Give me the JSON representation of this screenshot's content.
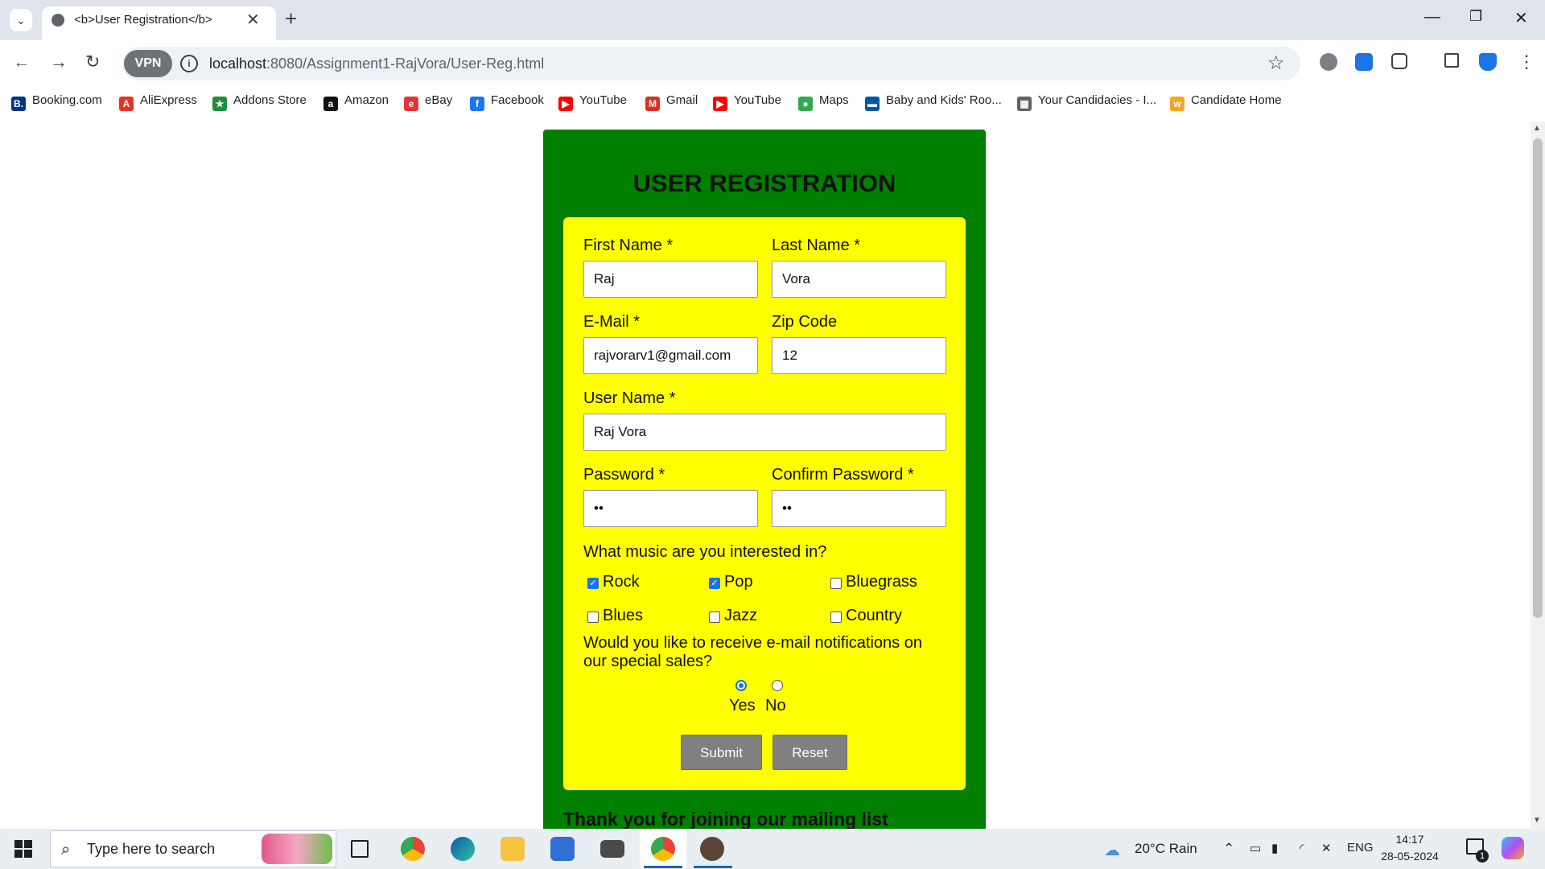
{
  "browser": {
    "tab_title": "<b>User Registration</b>",
    "new_tab": "+",
    "url_host": "localhost",
    "url_rest": ":8080/Assignment1-RajVora/User-Reg.html",
    "vpn_label": "VPN",
    "bookmarks": [
      {
        "label": "Booking.com",
        "icon": "booking-icon",
        "color": "#003580",
        "glyph": "B."
      },
      {
        "label": "AliExpress",
        "icon": "aliexpress-icon",
        "color": "#e43225",
        "glyph": "A"
      },
      {
        "label": "Addons Store",
        "icon": "addons-icon",
        "color": "#1e8e3e",
        "glyph": "★"
      },
      {
        "label": "Amazon",
        "icon": "amazon-icon",
        "color": "#111111",
        "glyph": "a"
      },
      {
        "label": "eBay",
        "icon": "ebay-icon",
        "color": "#e53238",
        "glyph": "e"
      },
      {
        "label": "Facebook",
        "icon": "facebook-icon",
        "color": "#1877f2",
        "glyph": "f"
      },
      {
        "label": "YouTube",
        "icon": "youtube-icon",
        "color": "#ff0000",
        "glyph": "▶"
      },
      {
        "label": "Gmail",
        "icon": "gmail-icon",
        "color": "#d93025",
        "glyph": "M"
      },
      {
        "label": "YouTube",
        "icon": "youtube-icon",
        "color": "#ff0000",
        "glyph": "▶"
      },
      {
        "label": "Maps",
        "icon": "maps-icon",
        "color": "#34a853",
        "glyph": "●"
      },
      {
        "label": "Baby and Kids' Roo...",
        "icon": "ikea-icon",
        "color": "#0058a3",
        "glyph": "▬"
      },
      {
        "label": "Your Candidacies - I...",
        "icon": "candidacies-icon",
        "color": "#5f6368",
        "glyph": "▦"
      },
      {
        "label": "Candidate Home",
        "icon": "workday-icon",
        "color": "#f5a623",
        "glyph": "w"
      }
    ]
  },
  "form": {
    "title": "USER REGISTRATION",
    "first_name_label": "First Name *",
    "first_name_value": "Raj",
    "last_name_label": "Last Name *",
    "last_name_value": "Vora",
    "email_label": "E-Mail *",
    "email_value": "rajvorarv1@gmail.com",
    "zip_label": "Zip Code",
    "zip_value": "12",
    "username_label": "User Name *",
    "username_value": "Raj Vora",
    "password_label": "Password *",
    "password_value": "••",
    "confirm_label": "Confirm Password *",
    "confirm_value": "••",
    "music_question": "What music are you interested in?",
    "music": [
      {
        "label": "Rock",
        "checked": true
      },
      {
        "label": "Pop",
        "checked": true
      },
      {
        "label": "Bluegrass",
        "checked": false
      },
      {
        "label": "Blues",
        "checked": false
      },
      {
        "label": "Jazz",
        "checked": false
      },
      {
        "label": "Country",
        "checked": false
      }
    ],
    "notify_question": "Would you like to receive e-mail notifications on our special sales?",
    "notify_yes": "Yes",
    "notify_no": "No",
    "notify_selected": "Yes",
    "submit": "Submit",
    "reset": "Reset",
    "thanks": "Thank you for joining our mailing list"
  },
  "taskbar": {
    "search_placeholder": "Type here to search",
    "weather": "20°C  Rain",
    "lang": "ENG",
    "time": "14:17",
    "date": "28-05-2024",
    "notification_count": "1"
  }
}
